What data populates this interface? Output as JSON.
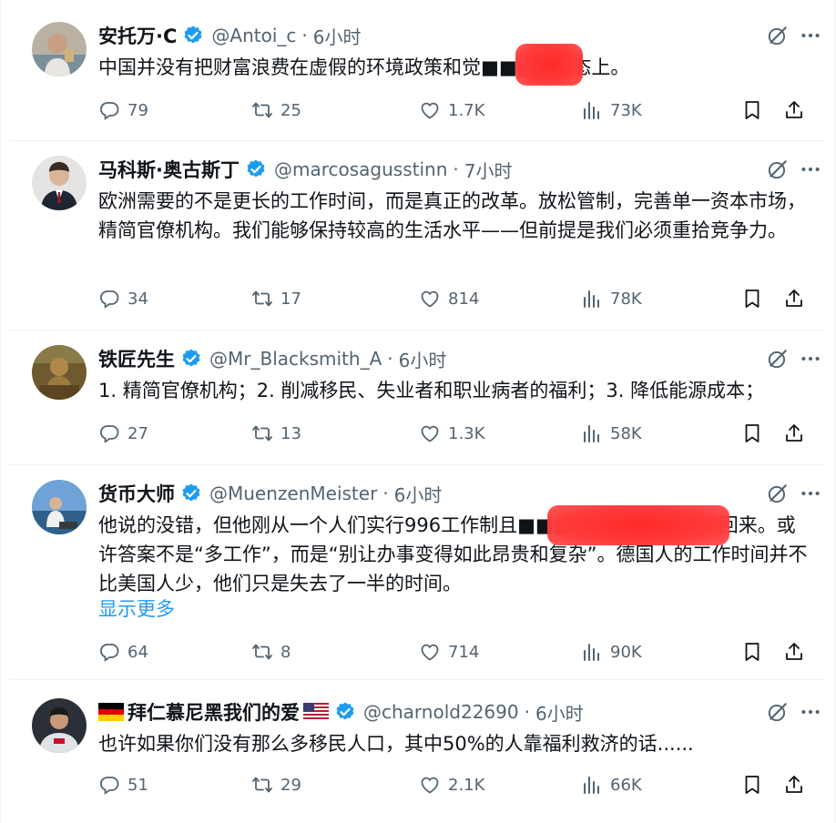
{
  "colors": {
    "accent": "#1d9bf0",
    "muted": "#536471",
    "text": "#0f1419",
    "redaction": "#ff2a2a"
  },
  "icons": {
    "reply": "reply-icon",
    "retweet": "retweet-icon",
    "like": "like-icon",
    "views": "views-icon",
    "bookmark": "bookmark-icon",
    "share": "share-icon",
    "grok": "grok-icon",
    "more": "more-icon",
    "verified": "verified-badge-icon"
  },
  "tweets": [
    {
      "name": "安托万·C",
      "handle": "@Antoi_c",
      "sep": "·",
      "time": "6小时",
      "text": "中国并没有把财富浪费在虚假的环境政策和觉■■■■形态上。",
      "replies": "79",
      "retweets": "25",
      "likes": "1.7K",
      "views": "73K"
    },
    {
      "name": "马科斯·奥古斯丁",
      "handle": "@marcosagusstinn",
      "sep": "·",
      "time": "7小时",
      "text": "欧洲需要的不是更长的工作时间，而是真正的改革。放松管制，完善单一资本市场，精简官僚机构。我们能够保持较高的生活水平——但前提是我们必须重拾竞争力。",
      "replies": "34",
      "retweets": "17",
      "likes": "814",
      "views": "78K"
    },
    {
      "name": "铁匠先生",
      "handle": "@Mr_Blacksmith_A",
      "sep": "·",
      "time": "6小时",
      "text": "1. 精简官僚机构；2. 削减移民、失业者和职业病者的福利；3. 降低能源成本；",
      "replies": "27",
      "retweets": "13",
      "likes": "1.3K",
      "views": "58K"
    },
    {
      "name": "货币大师",
      "handle": "@MuenzenMeister",
      "sep": "·",
      "time": "6小时",
      "text": "他说的没错，但他刚从一个人们实行996工作制且■■■■■■■■的国家回来。或许答案不是“多工作”，而是“别让办事变得如此昂贵和复杂”。德国人的工作时间并不比美国人少，他们只是失去了一半的时间。",
      "show_more": "显示更多",
      "replies": "64",
      "retweets": "8",
      "likes": "714",
      "views": "90K"
    },
    {
      "name": "拜仁慕尼黑我们的爱",
      "handle": "@charnold22690",
      "sep": "·",
      "time": "6小时",
      "text": "也许如果你们没有那么多移民人口，其中50%的人靠福利救济的话......",
      "replies": "51",
      "retweets": "29",
      "likes": "2.1K",
      "views": "66K"
    }
  ]
}
